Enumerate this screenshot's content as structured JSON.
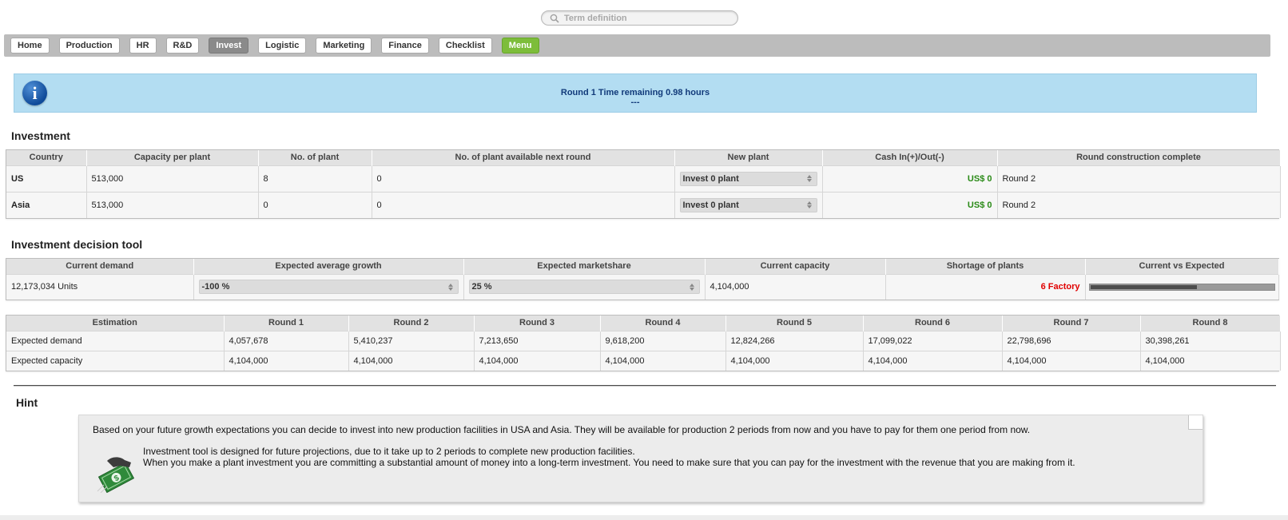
{
  "search": {
    "placeholder": "Term definition",
    "icon": "search-icon"
  },
  "nav": {
    "items": [
      {
        "label": "Home"
      },
      {
        "label": "Production"
      },
      {
        "label": "HR"
      },
      {
        "label": "R&D"
      },
      {
        "label": "Invest",
        "active": true
      },
      {
        "label": "Logistic"
      },
      {
        "label": "Marketing"
      },
      {
        "label": "Finance"
      },
      {
        "label": "Checklist"
      }
    ],
    "menu_label": "Menu",
    "colors": {
      "bar": "#bcbcbc",
      "active": "#8a8a8a",
      "menu": "#7dbd3a"
    }
  },
  "info": {
    "icon": "info-icon",
    "icon_glyph": "i",
    "line1": "Round 1 Time remaining 0.98 hours",
    "line2": "---",
    "color": "#b3ddf2"
  },
  "investment": {
    "title": "Investment",
    "headers": [
      "Country",
      "Capacity per plant",
      "No. of plant",
      "No. of plant available next round",
      "New plant",
      "Cash In(+)/Out(-)",
      "Round construction complete"
    ],
    "rows": [
      {
        "country": "US",
        "capacity": "513,000",
        "plants": "8",
        "available": "0",
        "new_plant": "Invest 0 plant",
        "cash": "US$ 0",
        "complete": "Round 2"
      },
      {
        "country": "Asia",
        "capacity": "513,000",
        "plants": "0",
        "available": "0",
        "new_plant": "Invest 0 plant",
        "cash": "US$ 0",
        "complete": "Round 2"
      }
    ]
  },
  "decision": {
    "title": "Investment decision tool",
    "headers": [
      "Current demand",
      "Expected average growth",
      "Expected marketshare",
      "Current capacity",
      "Shortage of plants",
      "Current vs Expected"
    ],
    "current_demand": "12,173,034 Units",
    "growth": "-100 %",
    "marketshare": "25 %",
    "current_capacity": "4,104,000",
    "shortage": "6 Factory",
    "current_vs_expected_fraction": 0.58
  },
  "estimation": {
    "headers": [
      "Estimation",
      "Round 1",
      "Round 2",
      "Round 3",
      "Round 4",
      "Round 5",
      "Round 6",
      "Round 7",
      "Round 8"
    ],
    "rows": [
      {
        "label": "Expected demand",
        "values": [
          "4,057,678",
          "5,410,237",
          "7,213,650",
          "9,618,200",
          "12,824,266",
          "17,099,022",
          "22,798,696",
          "30,398,261"
        ]
      },
      {
        "label": "Expected capacity",
        "values": [
          "4,104,000",
          "4,104,000",
          "4,104,000",
          "4,104,000",
          "4,104,000",
          "4,104,000",
          "4,104,000",
          "4,104,000"
        ]
      }
    ]
  },
  "hint": {
    "title": "Hint",
    "p1": "Based on your future growth expectations you can decide to invest into new production facilities in USA and Asia. They will be available for production 2 periods from now and you have to pay for them one period from now.",
    "p2a": "Investment tool is designed for future projections, due to it take up to 2 periods to complete new production facilities.",
    "p2b": "When you make a plant investment you are committing a substantial amount of money into a long-term investment. You need to make sure that you can pay for the investment with the revenue that you are making from it.",
    "image": "money-hand-icon"
  }
}
